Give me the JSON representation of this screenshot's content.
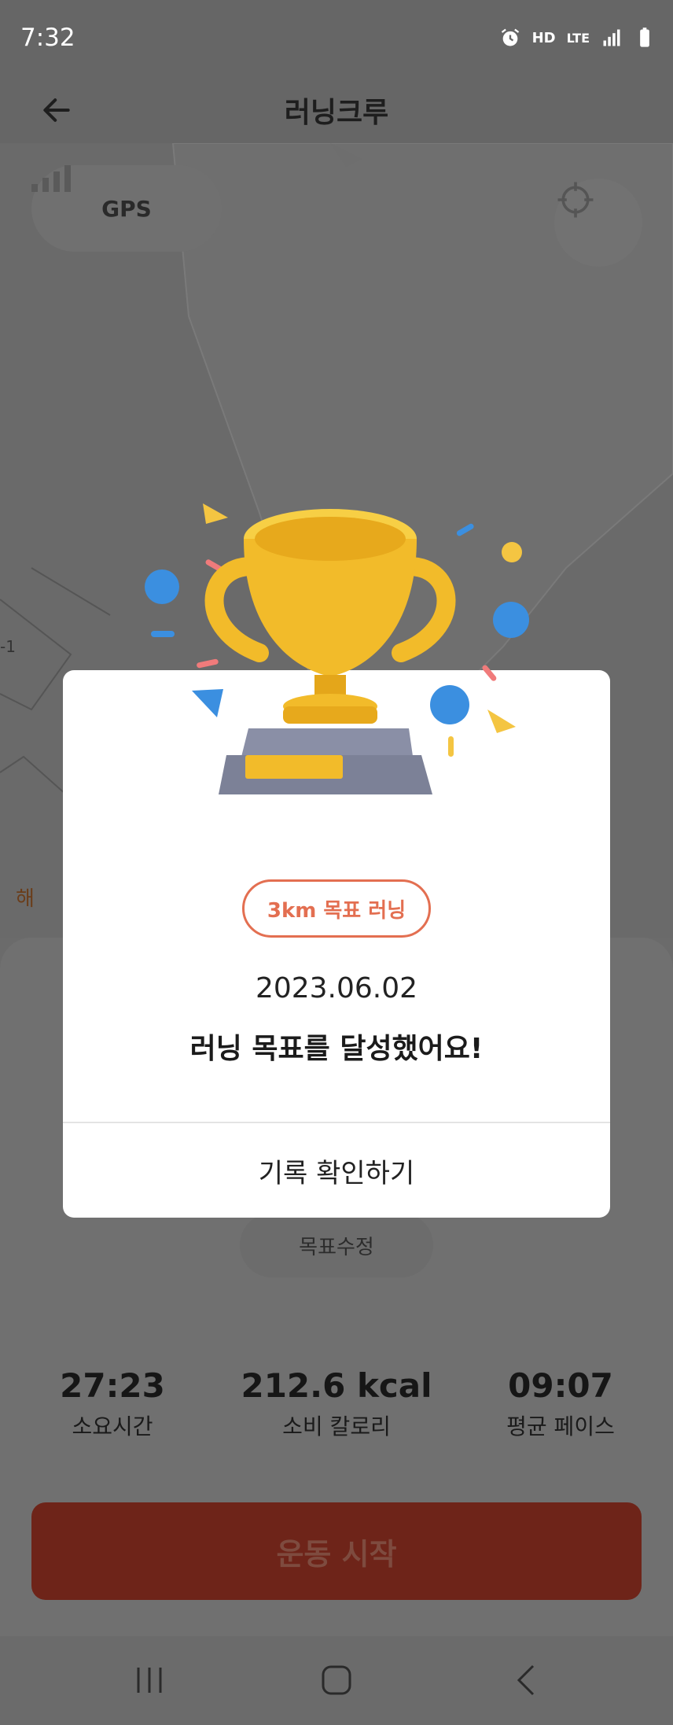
{
  "status_bar": {
    "time": "7:32",
    "icons": [
      "alarm-icon",
      "hd-voice-icon",
      "lte-icon",
      "signal-icon",
      "battery-icon"
    ],
    "hd_label": "HD",
    "lte_label": "LTE"
  },
  "header": {
    "title": "러닝크루",
    "back_icon": "arrow-left-icon"
  },
  "map": {
    "gps_label": "GPS",
    "gps_icon": "signal-bars-icon",
    "locate_icon": "crosshair-icon",
    "label_left": "-1",
    "label_bottom": "해"
  },
  "bottom_sheet": {
    "goal_edit_label": "목표수정",
    "stats": [
      {
        "value": "27:23",
        "label": "소요시간"
      },
      {
        "value": "212.6 kcal",
        "label": "소비 칼로리"
      },
      {
        "value": "09:07",
        "label": "평균 페이스"
      }
    ],
    "start_label": "운동 시작"
  },
  "modal": {
    "trophy_icon": "trophy-icon",
    "goal_badge": "3km 목표 러닝",
    "date": "2023.06.02",
    "message": "러닝 목표를 달성했어요!",
    "confirm_label": "기록 확인하기"
  },
  "nav": {
    "recents_icon": "recents-icon",
    "home_icon": "home-icon",
    "back_icon": "back-chevron-icon"
  },
  "colors": {
    "accent": "#e36f51",
    "start_button_dim": "#6e2419",
    "overlay": "#6b6b6b"
  }
}
